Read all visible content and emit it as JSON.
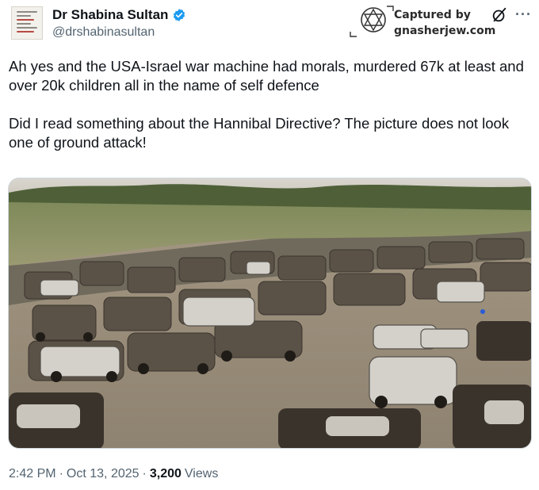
{
  "author": {
    "display_name": "Dr Shabina Sultan",
    "handle": "@drshabinasultan"
  },
  "watermark": {
    "line1": "Captured by",
    "line2": "gnasherjew.com"
  },
  "icons": {
    "verified": "verified-badge-icon",
    "grok": "grok-icon",
    "more": "more-options-icon"
  },
  "tweet": {
    "paragraph1": "Ah yes and the USA-Israel war machine had morals, murdered 67k at least and over 20k children all in the name of self defence",
    "paragraph2": "Did I read something about the Hannibal Directive? The picture does not look one of ground attack!"
  },
  "meta": {
    "time": "2:42 PM",
    "separator": "·",
    "date": "Oct 13, 2025",
    "views_count": "3,200",
    "views_label": "Views"
  },
  "colors": {
    "verified_blue": "#1d9bf0",
    "secondary_text": "#536471",
    "primary_text": "#0f1419"
  }
}
